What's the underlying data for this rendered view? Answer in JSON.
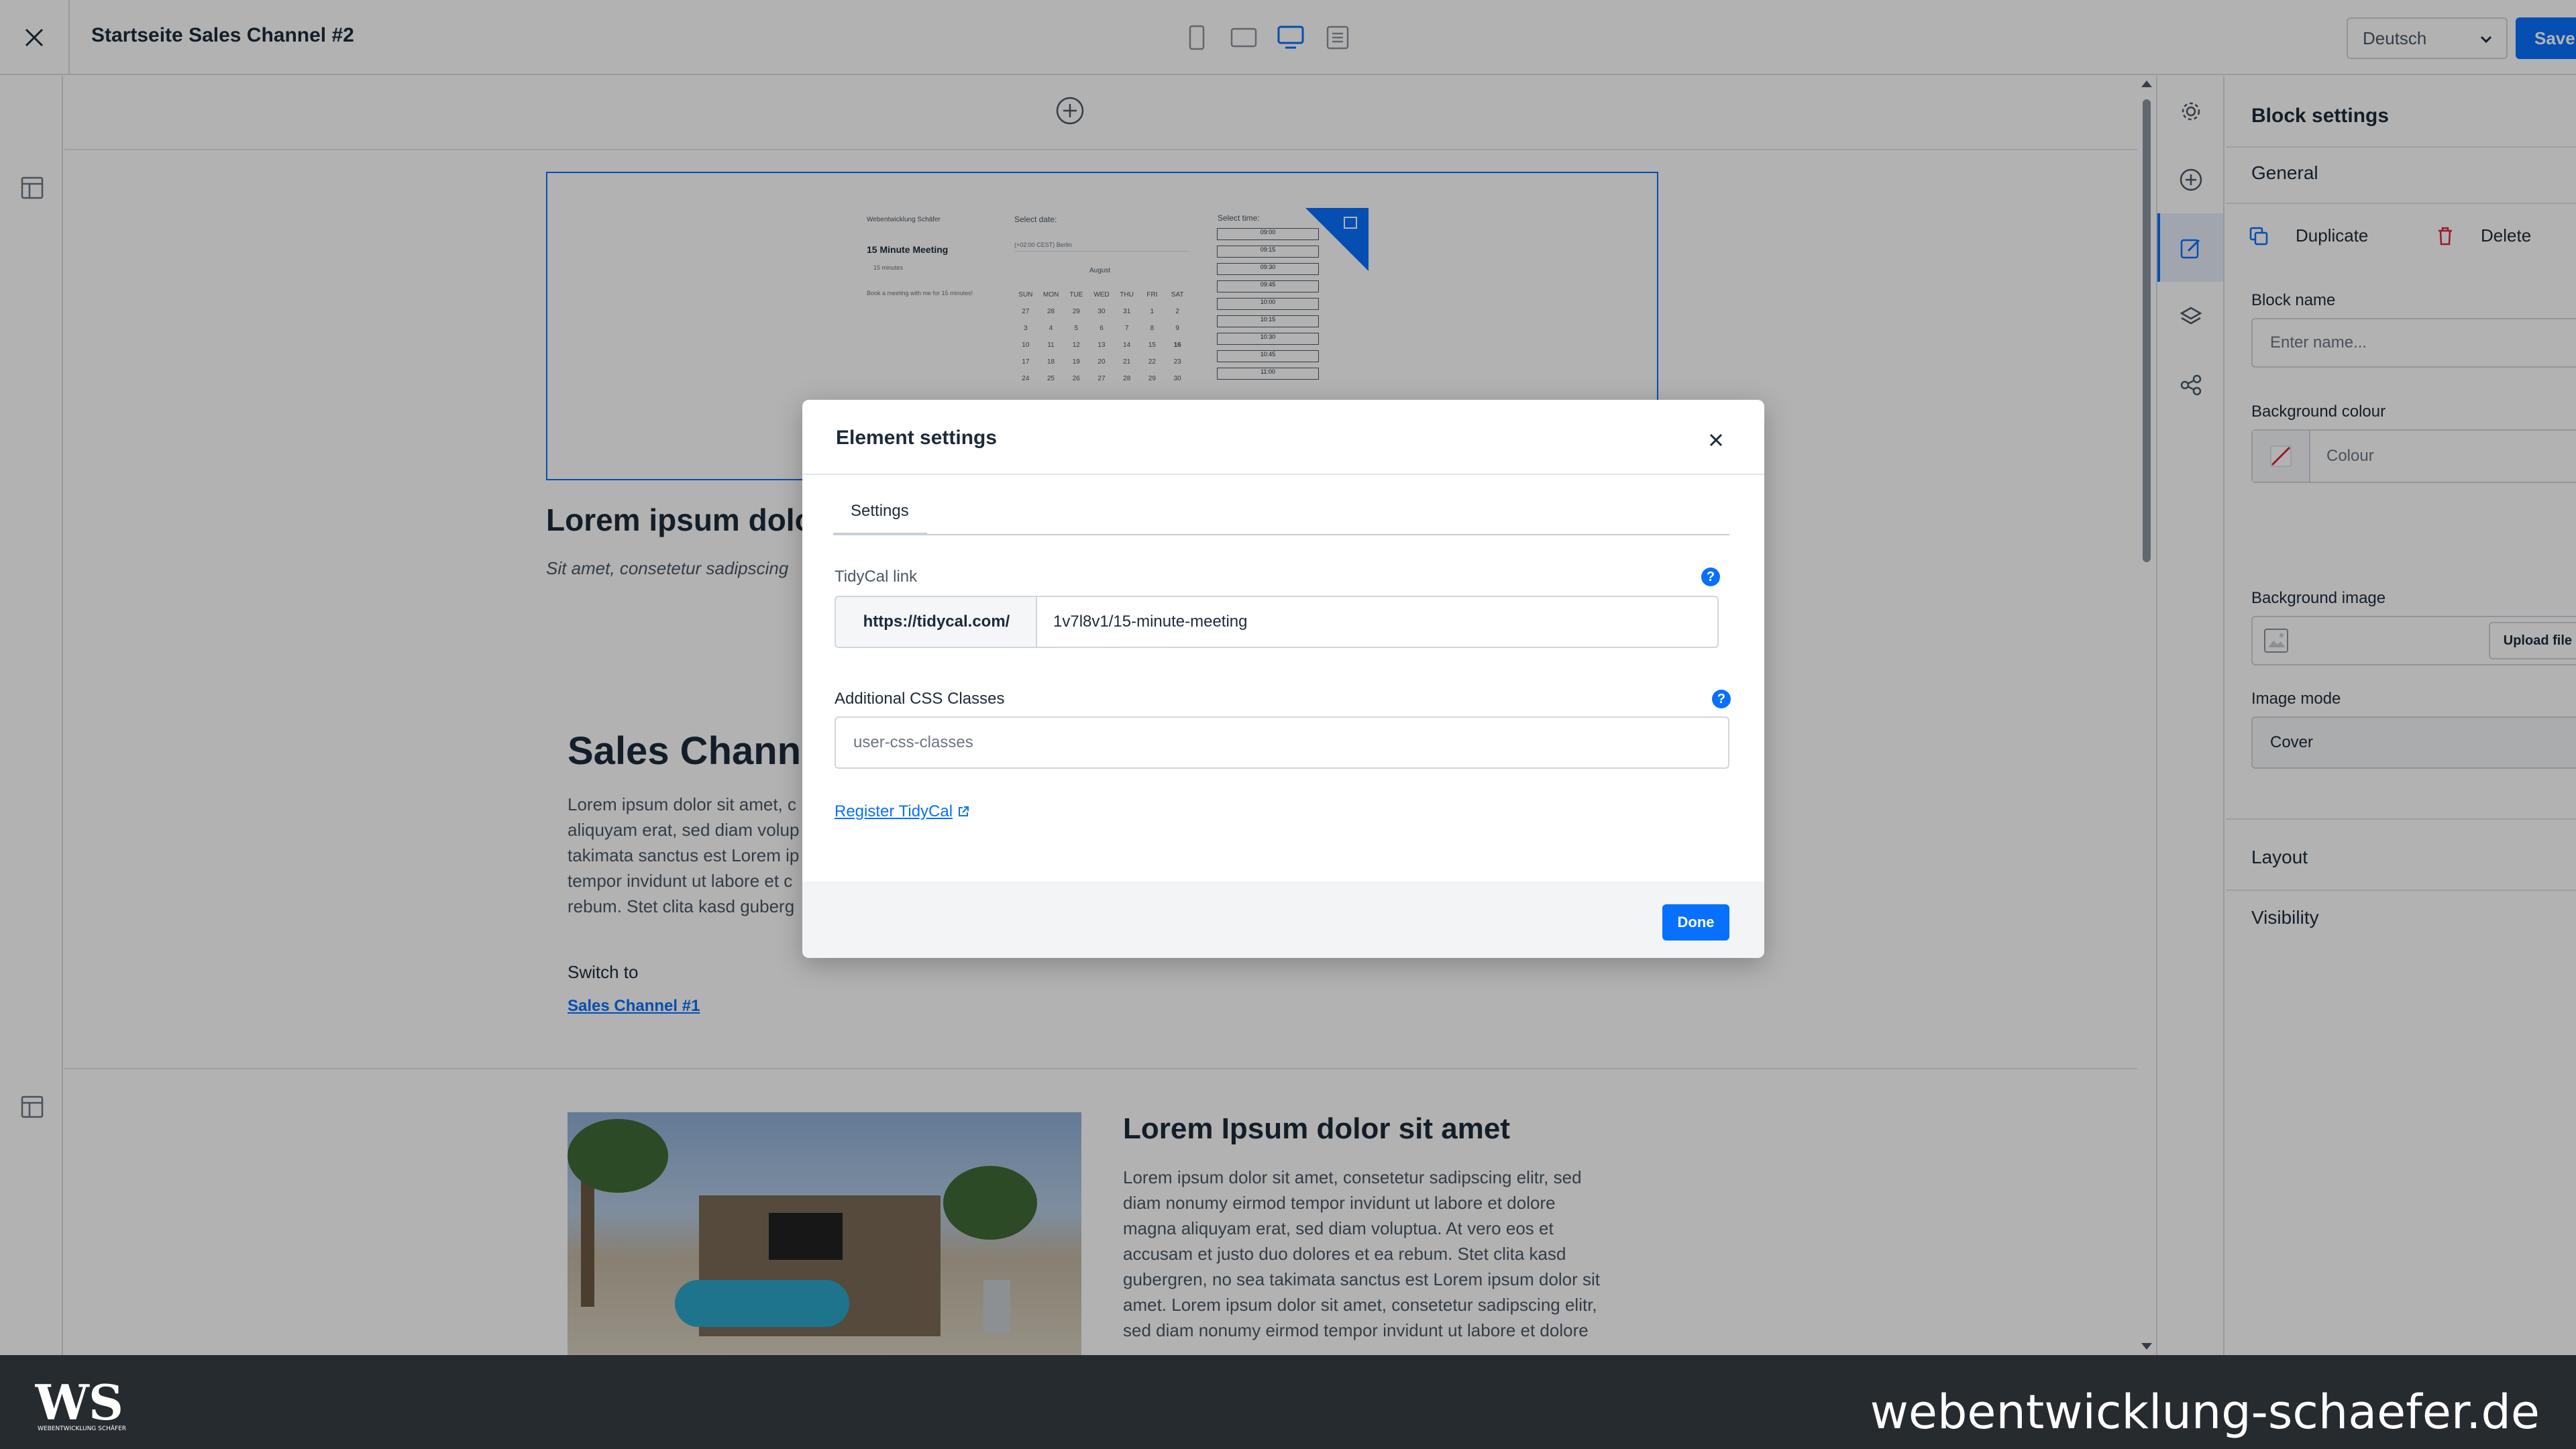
{
  "header": {
    "page_title": "Startseite Sales Channel #2",
    "language": "Deutsch",
    "save_label": "Save"
  },
  "canvas": {
    "block1": {
      "heading": "Lorem ipsum dolo",
      "subline": "Sit amet, consetetur sadipscing"
    },
    "calendar_preview": {
      "brand": "Webentwicklung Schäfer",
      "meeting_title": "15 Minute Meeting",
      "duration": "15 minutes",
      "description": "Book a meeting with me for 15 minutes!",
      "select_date": "Select date:",
      "select_time": "Select time:",
      "timezone": "(+02:00 CEST) Berlin",
      "month": "August",
      "weekdays": [
        "SUN",
        "MON",
        "TUE",
        "WED",
        "THU",
        "FRI",
        "SAT"
      ],
      "week_rows": [
        [
          "27",
          "28",
          "29",
          "30",
          "31",
          "1",
          "2"
        ],
        [
          "3",
          "4",
          "5",
          "6",
          "7",
          "8",
          "9"
        ],
        [
          "10",
          "11",
          "12",
          "13",
          "14",
          "15",
          "16"
        ],
        [
          "17",
          "18",
          "19",
          "20",
          "21",
          "22",
          "23"
        ],
        [
          "24",
          "25",
          "26",
          "27",
          "28",
          "29",
          "30"
        ]
      ],
      "times": [
        "09:00",
        "09:15",
        "09:30",
        "09:45",
        "10:00",
        "10:15",
        "10:30",
        "10:45",
        "11:00"
      ]
    },
    "block2": {
      "heading": "Sales Chann",
      "lines": [
        "Lorem ipsum dolor sit amet, c",
        "aliquyam erat, sed diam volup",
        "takimata sanctus est Lorem ip",
        "tempor invidunt ut labore et c",
        "rebum. Stet clita kasd guberg"
      ],
      "switch_label": "Switch to",
      "switch_link": "Sales Channel #1"
    },
    "block3": {
      "heading": "Lorem Ipsum dolor sit amet",
      "lines": [
        "Lorem ipsum dolor sit amet, consetetur sadipscing elitr, sed",
        "diam nonumy eirmod tempor invidunt ut labore et dolore",
        "magna aliquyam erat, sed diam voluptua. At vero eos et",
        "accusam et justo duo dolores et ea rebum. Stet clita kasd",
        "gubergren, no sea takimata sanctus est Lorem ipsum dolor sit",
        "amet. Lorem ipsum dolor sit amet, consetetur sadipscing elitr,",
        "sed diam nonumy eirmod tempor invidunt ut labore et dolore"
      ]
    }
  },
  "panel": {
    "title": "Block settings",
    "general": "General",
    "duplicate": "Duplicate",
    "delete": "Delete",
    "block_name_label": "Block name",
    "block_name_placeholder": "Enter name...",
    "bg_colour_label": "Background colour",
    "bg_colour_placeholder": "Colour",
    "bg_image_label": "Background image",
    "upload": "Upload file",
    "image_mode_label": "Image mode",
    "image_mode_value": "Cover",
    "layout": "Layout",
    "visibility": "Visibility"
  },
  "modal": {
    "title": "Element settings",
    "tab": "Settings",
    "tidycal_label": "TidyCal link",
    "tidycal_prefix": "https://tidycal.com/",
    "tidycal_value": "1v7l8v1/15-minute-meeting",
    "css_label": "Additional CSS Classes",
    "css_placeholder": "user-css-classes",
    "help": "?",
    "register": "Register TidyCal",
    "done": "Done"
  },
  "brand": {
    "url": "webentwicklung-schaefer.de",
    "logo_text": "WEBENTWICKLUNG SCHÄFER"
  }
}
